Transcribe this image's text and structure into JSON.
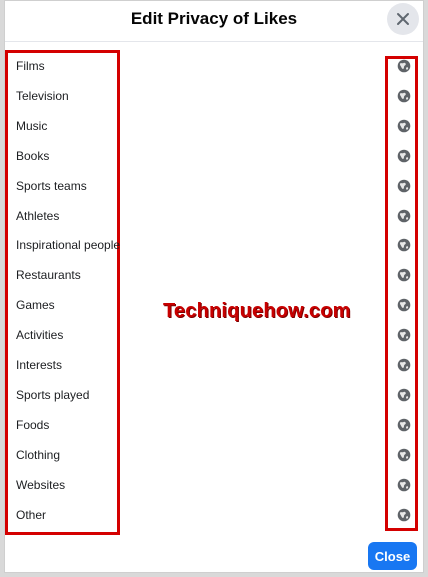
{
  "dialog": {
    "title": "Edit Privacy of Likes",
    "close_button_label": "Close",
    "watermark": "Techniquehow.com"
  },
  "categories": [
    {
      "label": "Films",
      "privacy_icon": "globe-icon"
    },
    {
      "label": "Television",
      "privacy_icon": "globe-icon"
    },
    {
      "label": "Music",
      "privacy_icon": "globe-icon"
    },
    {
      "label": "Books",
      "privacy_icon": "globe-icon"
    },
    {
      "label": "Sports teams",
      "privacy_icon": "globe-icon"
    },
    {
      "label": "Athletes",
      "privacy_icon": "globe-icon"
    },
    {
      "label": "Inspirational people",
      "privacy_icon": "globe-icon"
    },
    {
      "label": "Restaurants",
      "privacy_icon": "globe-icon"
    },
    {
      "label": "Games",
      "privacy_icon": "globe-icon"
    },
    {
      "label": "Activities",
      "privacy_icon": "globe-icon"
    },
    {
      "label": "Interests",
      "privacy_icon": "globe-icon"
    },
    {
      "label": "Sports played",
      "privacy_icon": "globe-icon"
    },
    {
      "label": "Foods",
      "privacy_icon": "globe-icon"
    },
    {
      "label": "Clothing",
      "privacy_icon": "globe-icon"
    },
    {
      "label": "Websites",
      "privacy_icon": "globe-icon"
    },
    {
      "label": "Other",
      "privacy_icon": "globe-icon"
    }
  ],
  "colors": {
    "primary_button": "#1877f2",
    "highlight_border": "#d40000",
    "watermark": "#c80000"
  }
}
